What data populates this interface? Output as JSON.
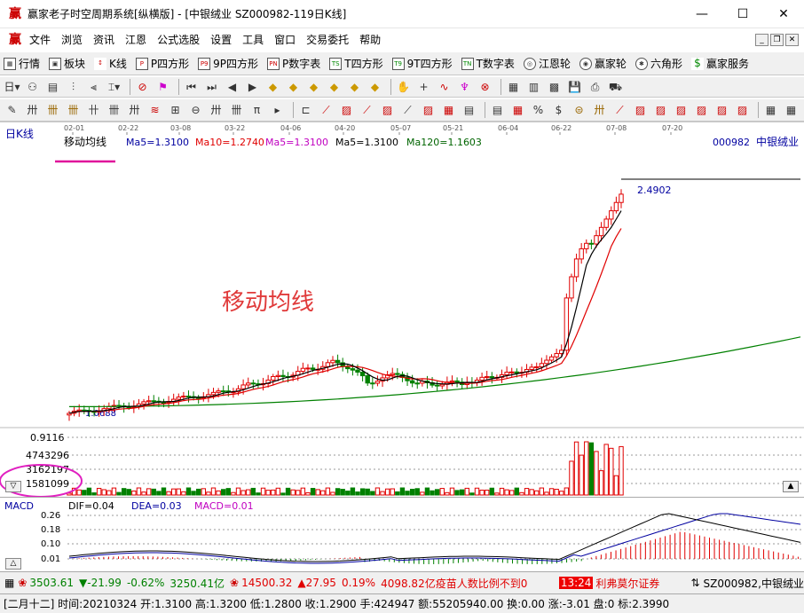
{
  "window": {
    "title": "赢家老子时空周期系统[纵横版] - [中银绒业  SZ000982-119日K线]",
    "icon": "win-logo-icon",
    "minimize": "—",
    "maximize": "☐",
    "close": "✕"
  },
  "menu": [
    "文件",
    "浏览",
    "资讯",
    "江恩",
    "公式选股",
    "设置",
    "工具",
    "窗口",
    "交易委托",
    "帮助"
  ],
  "toolbar1": [
    {
      "label": "行情",
      "icon": "grid-icon"
    },
    {
      "label": "板块",
      "icon": "blocks-icon"
    },
    {
      "label": "K线",
      "icon": "kline-icon"
    },
    {
      "label": "P四方形",
      "icon": "P"
    },
    {
      "label": "9P四方形",
      "icon": "P9"
    },
    {
      "label": "P数字表",
      "icon": "PN"
    },
    {
      "label": "T四方形",
      "icon": "TS"
    },
    {
      "label": "9T四方形",
      "icon": "T9"
    },
    {
      "label": "T数字表",
      "icon": "TN"
    },
    {
      "label": "江恩轮",
      "icon": "wheel-icon"
    },
    {
      "label": "赢家轮",
      "icon": "wheel-icon"
    },
    {
      "label": "六角形",
      "icon": "hexagon-icon"
    },
    {
      "label": "赢家服务",
      "icon": "dollar-icon"
    }
  ],
  "chart": {
    "period_label": "日K线",
    "indicator_title": "移动均线",
    "ma_labels": [
      {
        "text": "Ma5=1.3100",
        "color": "#0000a0"
      },
      {
        "text": "Ma10=1.2740",
        "color": "#e00000"
      },
      {
        "text": "Ma5=1.3100",
        "color": "#c000c0"
      },
      {
        "text": "Ma5=1.3100",
        "color": "#000000"
      },
      {
        "text": "Ma120=1.1603",
        "color": "#006400"
      }
    ],
    "stock_code": "000982",
    "stock_name": "中银绒业",
    "dates": [
      "02-01",
      "02-22",
      "03-08",
      "03-22",
      "04-06",
      "04-20",
      "05-07",
      "05-21",
      "06-04",
      "06-22",
      "07-08",
      "07-20"
    ],
    "annotation": "移动均线",
    "high_label": "2.4902",
    "low_label": "1.0688",
    "volume_axis": [
      "0.9116",
      "4743296",
      "3162197",
      "1581099"
    ]
  },
  "chart_data": {
    "type": "candlestick",
    "title": "",
    "price_high": 2.4902,
    "price_low": 1.0688,
    "ma": {
      "ma5": 1.31,
      "ma10": 1.274,
      "ma120": 1.1603
    }
  },
  "macd": {
    "title": "MACD",
    "dif": "DIF=0.04",
    "dea": "DEA=0.03",
    "macd": "MACD=0.01",
    "axis": [
      "0.26",
      "0.18",
      "0.10",
      "0.01"
    ]
  },
  "status": {
    "sh_index": "3503.61",
    "sh_change": "▼-21.99",
    "sh_pct": "-0.62%",
    "sh_amount": "3250.41亿",
    "sz_index": "14500.32",
    "sz_change": "▲27.95",
    "sz_pct": "0.19%",
    "sz_amount": "4098.82亿",
    "news": "疫苗人数比例不到0",
    "time": "13:24",
    "broker": "利弗莫尔证券",
    "stock": "SZ000982,中银绒业"
  },
  "info": "[二月十二] 时间:20210324 开:1.3100 高:1.3200 低:1.2800 收:1.2900 手:424947 额:55205940.00 换:0.00 涨:-3.01 盘:0 标:2.3990"
}
